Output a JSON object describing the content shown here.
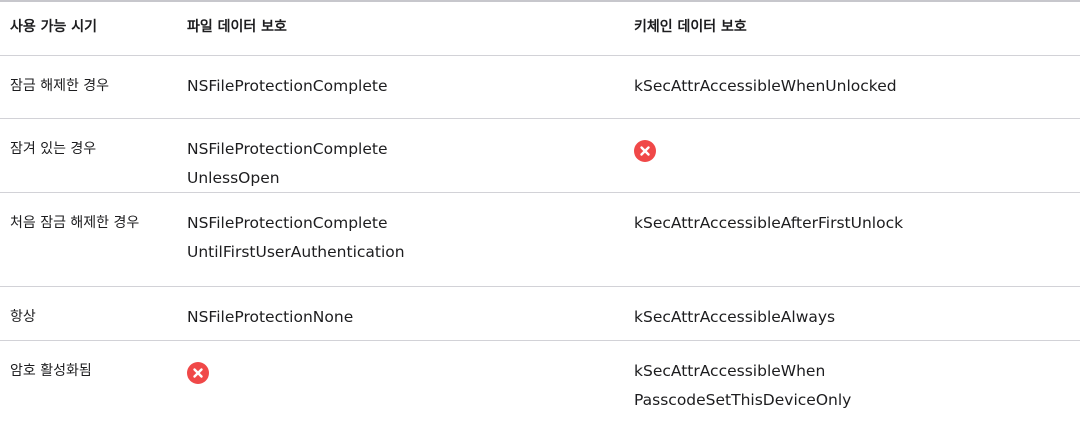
{
  "header": {
    "col1": "사용 가능 시기",
    "col2": "파일 데이터 보호",
    "col3": "키체인 데이터 보호"
  },
  "rows": [
    {
      "when": "잠금 해제한 경우",
      "file_line1": "NSFileProtectionComplete",
      "file_line2": "",
      "keychain_line1": "kSecAttrAccessibleWhenUnlocked",
      "keychain_line2": ""
    },
    {
      "when": "잠겨 있는 경우",
      "file_line1": "NSFileProtectionComplete",
      "file_line2": "UnlessOpen",
      "keychain_icon": "x-circle-icon"
    },
    {
      "when": "처음 잠금 해제한 경우",
      "file_line1": "NSFileProtectionComplete",
      "file_line2": "UntilFirstUserAuthentication",
      "keychain_line1": "kSecAttrAccessibleAfterFirstUnlock",
      "keychain_line2": ""
    },
    {
      "when": "항상",
      "file_line1": "NSFileProtectionNone",
      "file_line2": "",
      "keychain_line1": "kSecAttrAccessibleAlways",
      "keychain_line2": ""
    },
    {
      "when": "암호 활성화됨",
      "file_icon": "x-circle-icon",
      "keychain_line1": "kSecAttrAccessibleWhen",
      "keychain_line2": "PasscodeSetThisDeviceOnly"
    }
  ],
  "colors": {
    "x_icon": "#f04848",
    "border": "#d2d2d7",
    "text": "#1d1d1f"
  }
}
